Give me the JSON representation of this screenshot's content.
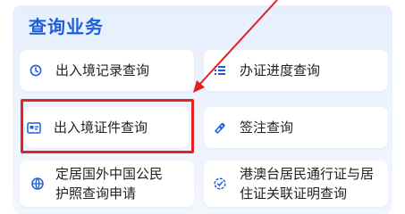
{
  "section": {
    "title": "查询业务"
  },
  "services": [
    {
      "label": "出入境记录查询",
      "icon": "clock-history-icon"
    },
    {
      "label": "办证进度查询",
      "icon": "list-progress-icon"
    },
    {
      "label": "出入境证件查询",
      "icon": "id-card-icon"
    },
    {
      "label": "签注查询",
      "icon": "endorsement-icon"
    },
    {
      "label": "定居国外中国公民护照查询申请",
      "icon": "globe-icon"
    },
    {
      "label": "港澳台居民通行证与居住证关联证明查询",
      "icon": "badge-icon"
    }
  ],
  "colors": {
    "accent": "#1d5fd8",
    "highlight": "#e02222",
    "panel_bg": "#e9f0fd"
  }
}
